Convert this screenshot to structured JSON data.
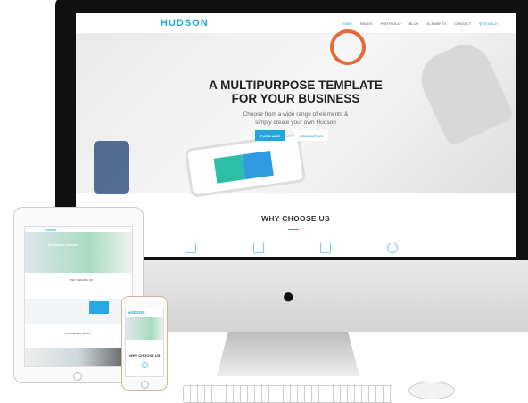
{
  "site": {
    "logo": "HUDSON",
    "nav": [
      "HOME",
      "PAGES",
      "PORTFOLIO",
      "BLOG",
      "ELEMENTS",
      "CONTACT",
      "SEARCH"
    ],
    "hero": {
      "title_line1": "A MULTIPURPOSE TEMPLATE",
      "title_line2": "FOR YOUR BUSINESS",
      "subtitle_line1": "Choose from a wide range of elements &",
      "subtitle_line2": "simply create your own Hudson",
      "purchase": "PURCHASE",
      "contact": "CONTACT US"
    },
    "section_title": "WHY CHOOSE US"
  },
  "tablet": {
    "logo": "HUDSON",
    "hero_title": "BUSINESS & CREATIVE",
    "section_title": "WHY CHOOSE US",
    "work_title": "OUR LATEST WORK"
  },
  "phone": {
    "logo": "HUDSON",
    "section_title": "WHY CHOOSE US"
  },
  "colors": {
    "accent": "#1fa8dc"
  }
}
